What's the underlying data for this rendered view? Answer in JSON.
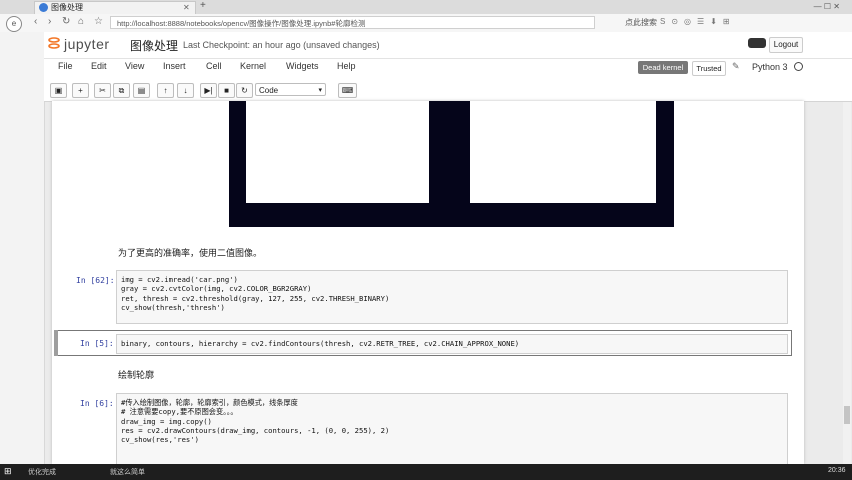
{
  "browser": {
    "tab_title": "图像处理",
    "url": "http://localhost:8888/notebooks/opencv/图像操作/图像处理.ipynb#轮廓检测",
    "search_hint": "点此搜索",
    "new_tab": "+"
  },
  "jupyter": {
    "logo_text": "jupyter",
    "notebook_title": "图像处理",
    "checkpoint": "Last Checkpoint: an hour ago (unsaved changes)",
    "logout": "Logout",
    "menu": [
      "File",
      "Edit",
      "View",
      "Insert",
      "Cell",
      "Kernel",
      "Widgets",
      "Help"
    ],
    "dead_kernel": "Dead kernel",
    "trusted": "Trusted",
    "kernel_name": "Python 3",
    "cell_type": "Code",
    "toolbar_icons": [
      "save-icon",
      "plus-icon",
      "cut-icon",
      "copy-icon",
      "paste-icon",
      "arrow-up-icon",
      "arrow-down-icon",
      "run-icon",
      "stop-icon",
      "restart-icon"
    ]
  },
  "cells": {
    "md1": "为了更高的准确率，使用二值图像。",
    "c62_prompt": "In [62]:",
    "c62_code": "img = cv2.imread('car.png')\ngray = cv2.cvtColor(img, cv2.COLOR_BGR2GRAY)\nret, thresh = cv2.threshold(gray, 127, 255, cv2.THRESH_BINARY)\ncv_show(thresh,'thresh')",
    "c5_prompt": "In [5]:",
    "c5_code": "binary, contours, hierarchy = cv2.findContours(thresh, cv2.RETR_TREE, cv2.CHAIN_APPROX_NONE)",
    "md2": "绘制轮廓",
    "c6_prompt": "In [6]:",
    "c6_code": "#传入绘制图像，轮廓，轮廓索引，颜色模式，线条厚度\n# 注意需要copy,要不原图会变。。。\ndraw_img = img.copy()\nres = cv2.drawContours(draw_img, contours, -1, (0, 0, 255), 2)\ncv_show(res,'res')"
  },
  "taskbar": {
    "status_left": "优化完成",
    "status_mid": "就这么简单",
    "time": "20:36"
  }
}
